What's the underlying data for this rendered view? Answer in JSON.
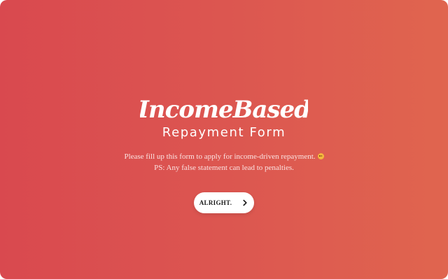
{
  "logo": {
    "script_text": "IncomeBased",
    "subtitle": "Repayment Form"
  },
  "intro": {
    "line1": "Please fill up this form to apply for income-driven repayment.",
    "line2": "PS: Any false statement can lead to penalties."
  },
  "cta": {
    "label": "ALRIGHT."
  },
  "colors": {
    "gradient_start": "#d9494f",
    "gradient_end": "#e0654f",
    "button_bg": "#ffffff"
  }
}
